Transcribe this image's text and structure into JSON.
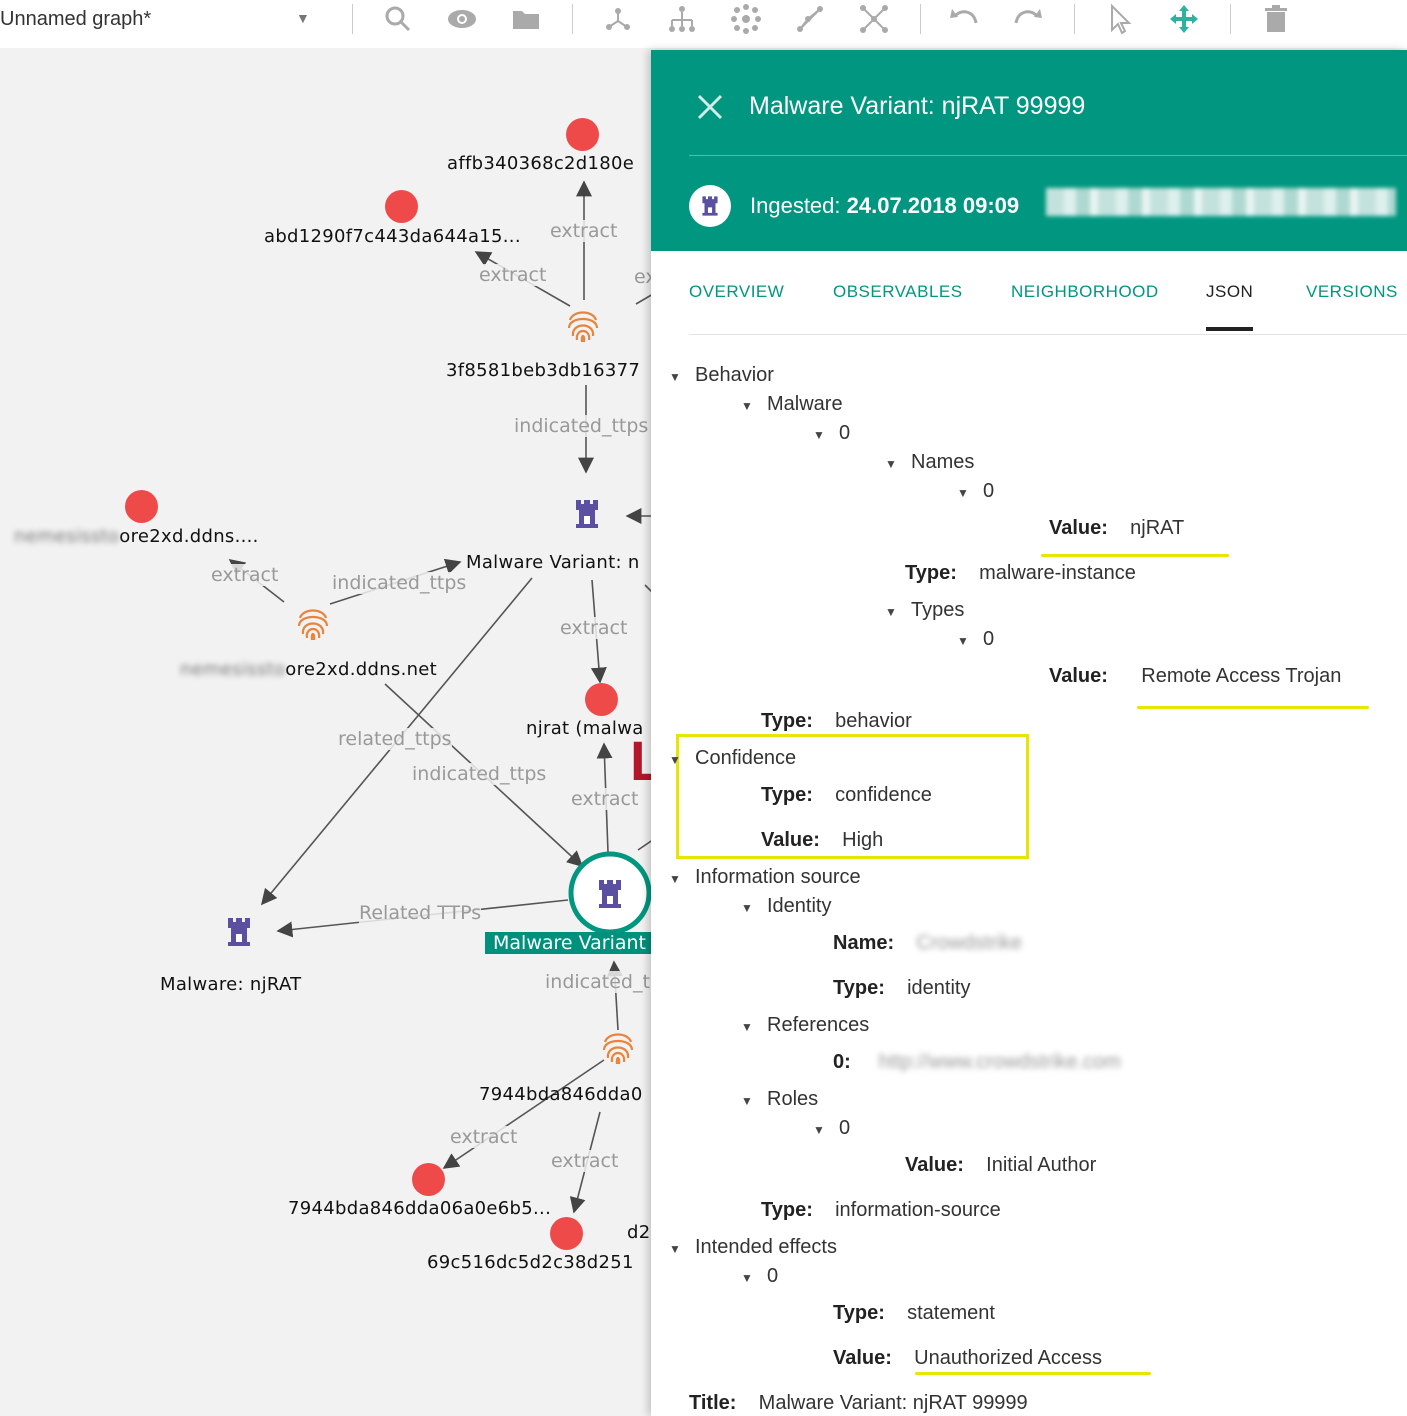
{
  "toolbar": {
    "graph_title": "Unnamed graph*",
    "icons": [
      "search-icon",
      "eye-icon",
      "folder-icon",
      "graph-layout-icon",
      "tree-layout-icon",
      "cluster-layout-icon",
      "path-icon",
      "expand-icon",
      "undo-icon",
      "redo-icon",
      "select-pointer-icon",
      "move-icon",
      "trash-icon"
    ]
  },
  "graph": {
    "nodes": {
      "n1": "affb340368c2d180e",
      "n2": "abd1290f7c443da644a15...",
      "n3": "3f8581beb3db16377",
      "n4_blur": "nemesissto",
      "n4": "ore2xd.ddns....",
      "n5": "Malware Variant: n",
      "n6_blur": "nemesissto",
      "n6": "ore2xd.ddns.net",
      "n7": "njrat (malwa",
      "n8": "Malware Variant",
      "n9": "Malware: njRAT",
      "n10": "7944bda846dda0",
      "n11": "7944bda846dda06a0e6b5...",
      "n12": "69c516dc5d2c38d251",
      "n13": "d2"
    },
    "edges": {
      "e1": "extract",
      "e2": "extract",
      "e3": "ex",
      "e4": "indicated_ttps",
      "e5": "extract",
      "e6": "indicated_ttps",
      "e7": "extract",
      "e8": "related_ttps",
      "e9": "indicated_ttps",
      "e10": "extract",
      "e11": "Related TTPs",
      "e12": "indicated_t",
      "e13": "extract",
      "e14": "extract"
    },
    "partial_letter": "L"
  },
  "panel": {
    "title": "Malware Variant: njRAT 99999",
    "ingested_label": "Ingested:",
    "ingested_value": "24.07.2018 09:09",
    "tabs": [
      "OVERVIEW",
      "OBSERVABLES",
      "NEIGHBORHOOD",
      "JSON",
      "VERSIONS"
    ],
    "active_tab": "JSON",
    "json": {
      "behavior": "Behavior",
      "malware": "Malware",
      "idx0": "0",
      "names": "Names",
      "value_key": "Value:",
      "type_key": "Type:",
      "names_value": "njRAT",
      "malware_type": "malware-instance",
      "types": "Types",
      "types_value": "Remote Access Trojan",
      "behavior_type": "behavior",
      "confidence": "Confidence",
      "confidence_type": "confidence",
      "confidence_value": "High",
      "info_source": "Information source",
      "identity": "Identity",
      "name_key": "Name:",
      "identity_name": "Crowdstrike",
      "identity_type": "identity",
      "references": "References",
      "ref_key": "0:",
      "ref_value": "http://www.crowdstrike.com",
      "roles": "Roles",
      "roles_value": "Initial Author",
      "info_type": "information-source",
      "intended_effects": "Intended effects",
      "effects_type": "statement",
      "effects_value": "Unauthorized Access",
      "title_key": "Title:",
      "title_value": "Malware Variant: njRAT 99999"
    }
  },
  "colors": {
    "teal": "#00967f",
    "red_node": "#ef4a4a",
    "fingerprint": "#e8843c",
    "castle": "#5a4fa0",
    "highlight": "#e6e600"
  }
}
